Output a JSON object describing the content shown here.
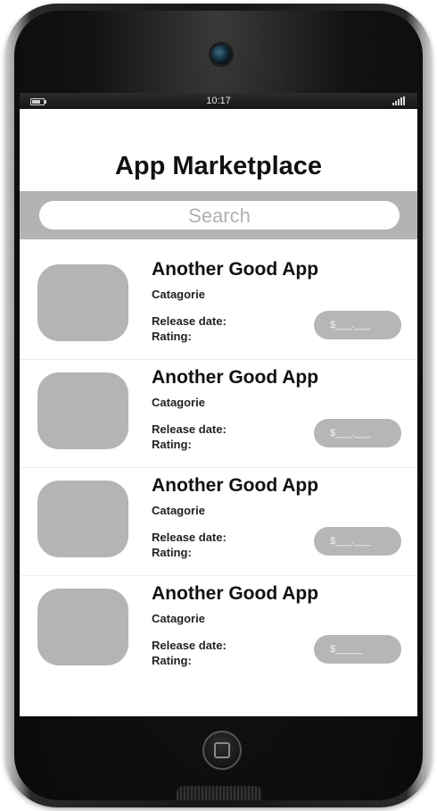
{
  "status_bar": {
    "time": "10:17"
  },
  "header": {
    "title": "App Marketplace"
  },
  "search": {
    "placeholder": "Search"
  },
  "apps": [
    {
      "name": "Another Good App",
      "category": "Catagorie",
      "release_label": "Release date:",
      "rating_label": "Rating:",
      "price_label": "$___.___"
    },
    {
      "name": "Another Good App",
      "category": "Catagorie",
      "release_label": "Release date:",
      "rating_label": "Rating:",
      "price_label": "$___.___"
    },
    {
      "name": "Another Good App",
      "category": "Catagorie",
      "release_label": "Release date:",
      "rating_label": "Rating:",
      "price_label": "$___.___"
    },
    {
      "name": "Another Good App",
      "category": "Catagorie",
      "release_label": "Release date:",
      "rating_label": "Rating:",
      "price_label": "$_____"
    }
  ],
  "colors": {
    "phone_body": "#151515",
    "search_bar_bg": "#b3b3b3",
    "icon_placeholder": "#b4b4b4",
    "price_button": "#b6b6b6"
  },
  "icons": [
    "battery-icon",
    "signal-icon",
    "camera-icon",
    "home-button-icon"
  ]
}
